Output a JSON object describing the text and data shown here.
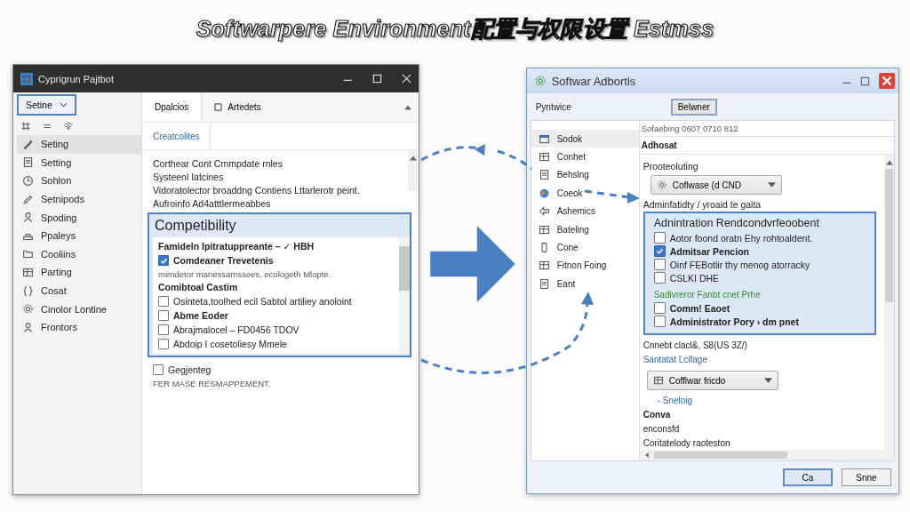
{
  "heading": "Softwarpere  Environment配置与权限设置 Estmss",
  "left_window": {
    "title": "Cyprigrun Pajtbot",
    "dropdown": "Setine",
    "sidebar": [
      {
        "label": "Seting",
        "selected": true
      },
      {
        "label": "Setting",
        "selected": false
      },
      {
        "label": "Sohlon",
        "selected": false
      },
      {
        "label": "Setnipods",
        "selected": false
      },
      {
        "label": "Spoding",
        "selected": false
      },
      {
        "label": "Ppaleys",
        "selected": false
      },
      {
        "label": "Cooliins",
        "selected": false
      },
      {
        "label": "Parting",
        "selected": false
      },
      {
        "label": "Cosat",
        "selected": false
      },
      {
        "label": "Cinolor Lontine",
        "selected": false
      },
      {
        "label": "Frontors",
        "selected": false
      }
    ],
    "tabs": [
      {
        "label": "Dpalcios",
        "selected": true
      },
      {
        "label": "Artedets",
        "selected": false
      }
    ],
    "subtab": "Creatcolites",
    "lines": [
      "Corthear Cont Cmmpdate rnles",
      "Systeenl Iatcines",
      "Vidoratolector broaddng Contiens Lttarlerotr peint.",
      "Aufroinfo Ad4atttlermeabbes"
    ],
    "popup": {
      "title": "Competibility",
      "rows": [
        {
          "kind": "bold",
          "text": "Famideln Ipitratuppreante – ✓ HBH"
        },
        {
          "kind": "check",
          "text": "Comdeaner Trevetenis",
          "checked": true,
          "bold": true
        },
        {
          "kind": "note",
          "text": "mendetor manessamssees, ecologeth Mlopte."
        },
        {
          "kind": "bold",
          "text": "Comibtoal Castim"
        },
        {
          "kind": "check",
          "text": "Osinteta,toolhed ecil Sabtol artiliey anoloint",
          "checked": false,
          "bold": false
        },
        {
          "kind": "check",
          "text": "Abme Eoder",
          "checked": false,
          "bold": true
        },
        {
          "kind": "check",
          "text": "Abrajmalocel – FD0456 TDOV",
          "checked": false,
          "bold": false
        },
        {
          "kind": "check",
          "text": "Abdoip I cosetoliesy Mmele",
          "checked": false,
          "bold": false
        }
      ]
    },
    "after": [
      {
        "kind": "check",
        "text": "Gegjenteg",
        "checked": false,
        "bold": false
      },
      {
        "kind": "note",
        "text": "FER MASE RESMAPPEMENT."
      }
    ]
  },
  "right_window": {
    "title": "Softwar Adbortls",
    "toolbar_label": "Pyntwice",
    "toolbar_button": "Belwner",
    "sidebar": [
      {
        "label": "Sodok",
        "selected": true
      },
      {
        "label": "Conhet",
        "selected": false
      },
      {
        "label": "Behsing",
        "selected": false
      },
      {
        "label": "Coeok",
        "selected": false
      },
      {
        "label": "Ashemics",
        "selected": false
      },
      {
        "label": "Bateling",
        "selected": false
      },
      {
        "label": "Cone",
        "selected": false
      },
      {
        "label": "Fitnon Foing",
        "selected": false
      },
      {
        "label": "Eant",
        "selected": false
      }
    ],
    "path": "Sofaebing 0607 0710 812",
    "section": "Adhosat",
    "field_label": "Prooteoluting",
    "dropdown": "Coflwase (d CND",
    "panel_label": "Adminfatidty / yroaid te gaita",
    "panel": {
      "title": "Adnintration Rendcondvrfeoobent",
      "rows": [
        {
          "kind": "check",
          "text": "Aotor foond oratn Ehy rohtoaldent.",
          "checked": false,
          "bold": false
        },
        {
          "kind": "check",
          "text": "Admitsar Pencion",
          "checked": true,
          "bold": true
        },
        {
          "kind": "check",
          "text": "Oinf FEBotlir thy menog atorracky",
          "checked": false,
          "bold": false
        },
        {
          "kind": "check",
          "text": "CSLKI DHE",
          "checked": false,
          "bold": false
        },
        {
          "kind": "green",
          "text": "Sadivreror Fanbt cnet Prhe"
        },
        {
          "kind": "check",
          "text": "Comm! Eaoet",
          "checked": false,
          "bold": true
        },
        {
          "kind": "check",
          "text": "Administrator Pory › dm pnet",
          "checked": false,
          "bold": true
        }
      ]
    },
    "below": [
      {
        "kind": "text",
        "text": "Cnnebt clacl&, S8(US 3Z/)"
      },
      {
        "kind": "link",
        "text": "Santatat Lcifage"
      },
      {
        "kind": "dropdown",
        "text": "Cofflwar fricdo"
      },
      {
        "kind": "indent",
        "text": "- Sneloig"
      },
      {
        "kind": "bold",
        "text": "Conva"
      },
      {
        "kind": "text",
        "text": "enconsfd"
      },
      {
        "kind": "text",
        "text": "Coritatelody raoteston"
      }
    ],
    "buttons": [
      {
        "label": "Ca",
        "primary": true
      },
      {
        "label": "Snne",
        "primary": false
      }
    ]
  }
}
